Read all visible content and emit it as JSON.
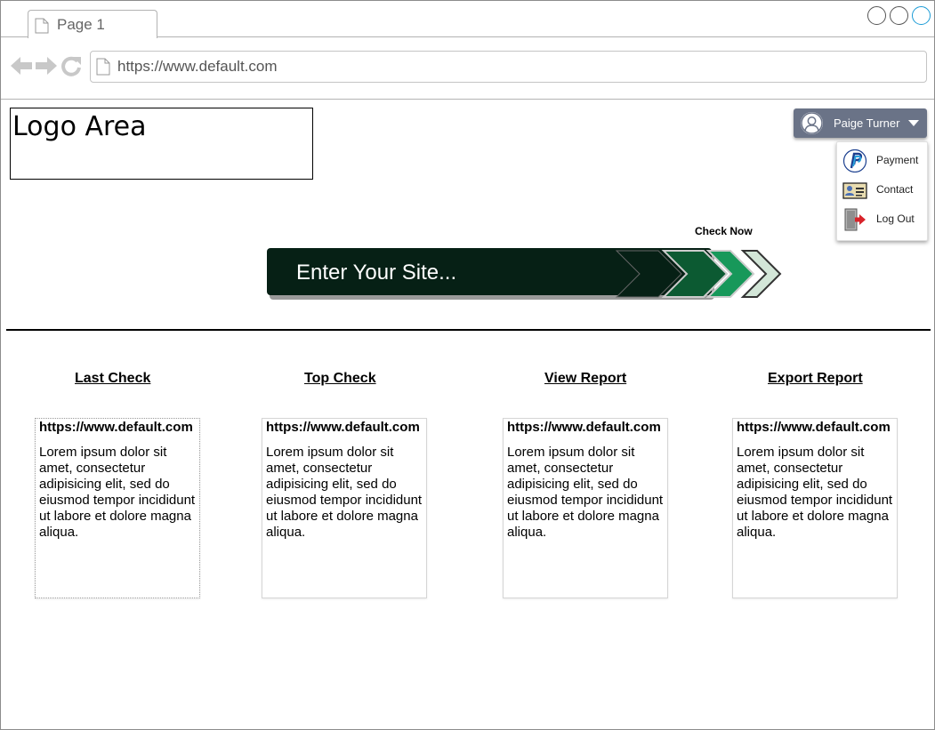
{
  "browser": {
    "tab_title": "Page 1",
    "url": "https://www.default.com"
  },
  "logo": {
    "text": "Logo Area"
  },
  "user": {
    "name": "Paige Turner",
    "menu": [
      {
        "label": "Payment",
        "icon": "paypal-icon"
      },
      {
        "label": "Contact",
        "icon": "contact-card-icon"
      },
      {
        "label": "Log Out",
        "icon": "logout-door-icon"
      }
    ]
  },
  "search": {
    "check_label": "Check Now",
    "placeholder": "Enter Your Site..."
  },
  "columns": [
    {
      "heading": "Last Check",
      "url": "https://www.default.com",
      "text": "Lorem ipsum dolor sit amet, consectetur adipisicing elit, sed do eiusmod tempor incididunt ut labore et dolore magna aliqua."
    },
    {
      "heading": "Top Check",
      "url": "https://www.default.com",
      "text": "Lorem ipsum dolor sit amet, consectetur adipisicing elit, sed do eiusmod tempor incididunt ut labore et dolore magna aliqua."
    },
    {
      "heading": "View Report",
      "url": "https://www.default.com",
      "text": "Lorem ipsum dolor sit amet, consectetur adipisicing elit, sed do eiusmod tempor incididunt ut labore et dolore magna aliqua."
    },
    {
      "heading": "Export Report",
      "url": "https://www.default.com",
      "text": "Lorem ipsum dolor sit amet, consectetur adipisicing elit, sed do eiusmod tempor incididunt ut labore et dolore magna aliqua."
    }
  ],
  "colors": {
    "user_menu_bg": "#6a7387",
    "search_bar_bg": "#062015",
    "chevron_1": "#062015",
    "chevron_2": "#0c5a32",
    "chevron_3": "#17985a",
    "chevron_4": "#d3e6d8"
  }
}
